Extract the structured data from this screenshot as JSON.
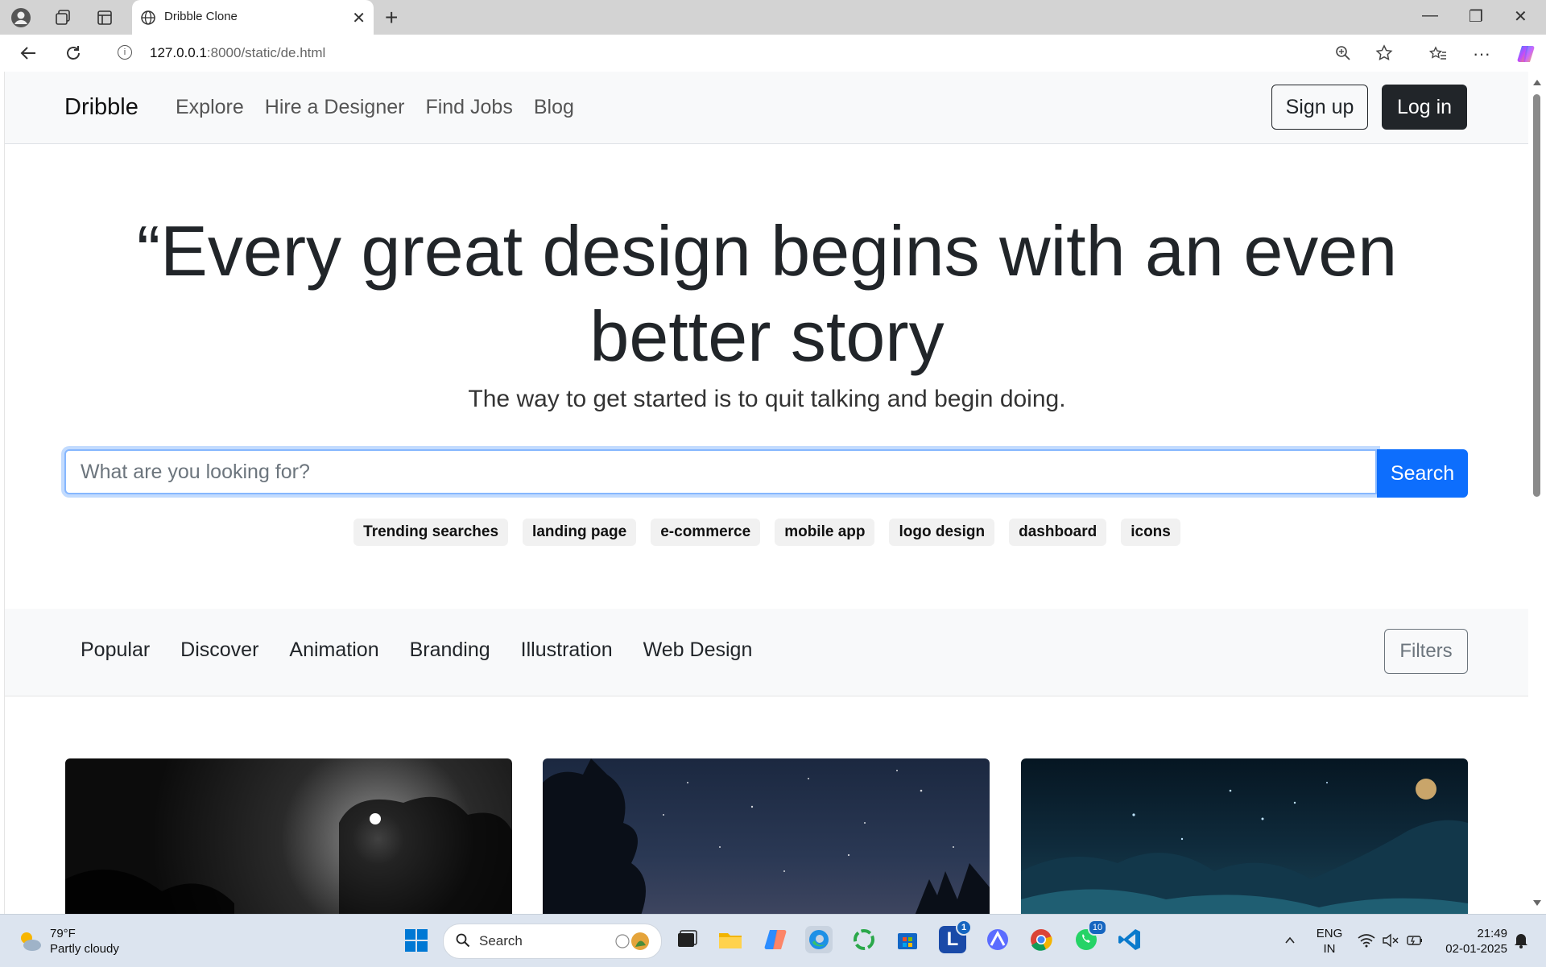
{
  "browser": {
    "tab_title": "Dribble Clone",
    "url_host": "127.0.0.1",
    "url_path": ":8000/static/de.html"
  },
  "navbar": {
    "brand": "Dribble",
    "links": [
      "Explore",
      "Hire a Designer",
      "Find Jobs",
      "Blog"
    ],
    "signup_label": "Sign up",
    "login_label": "Log in"
  },
  "hero": {
    "title": "“Every great design begins with an even better story",
    "subtitle": "The way to get started is to quit talking and begin doing."
  },
  "search": {
    "placeholder": "What are you looking for?",
    "button_label": "Search"
  },
  "trending": {
    "lead": "Trending searches",
    "tags": [
      "landing page",
      "e-commerce",
      "mobile app",
      "logo design",
      "dashboard",
      "icons"
    ]
  },
  "categories": {
    "items": [
      "Popular",
      "Discover",
      "Animation",
      "Branding",
      "Illustration",
      "Web Design"
    ],
    "filters_label": "Filters"
  },
  "taskbar": {
    "temp": "79°F",
    "condition": "Partly cloudy",
    "search_label": "Search",
    "lang_top": "ENG",
    "lang_bottom": "IN",
    "time": "21:49",
    "date": "02-01-2025",
    "badge_l": "1",
    "badge_whatsapp": "10"
  }
}
